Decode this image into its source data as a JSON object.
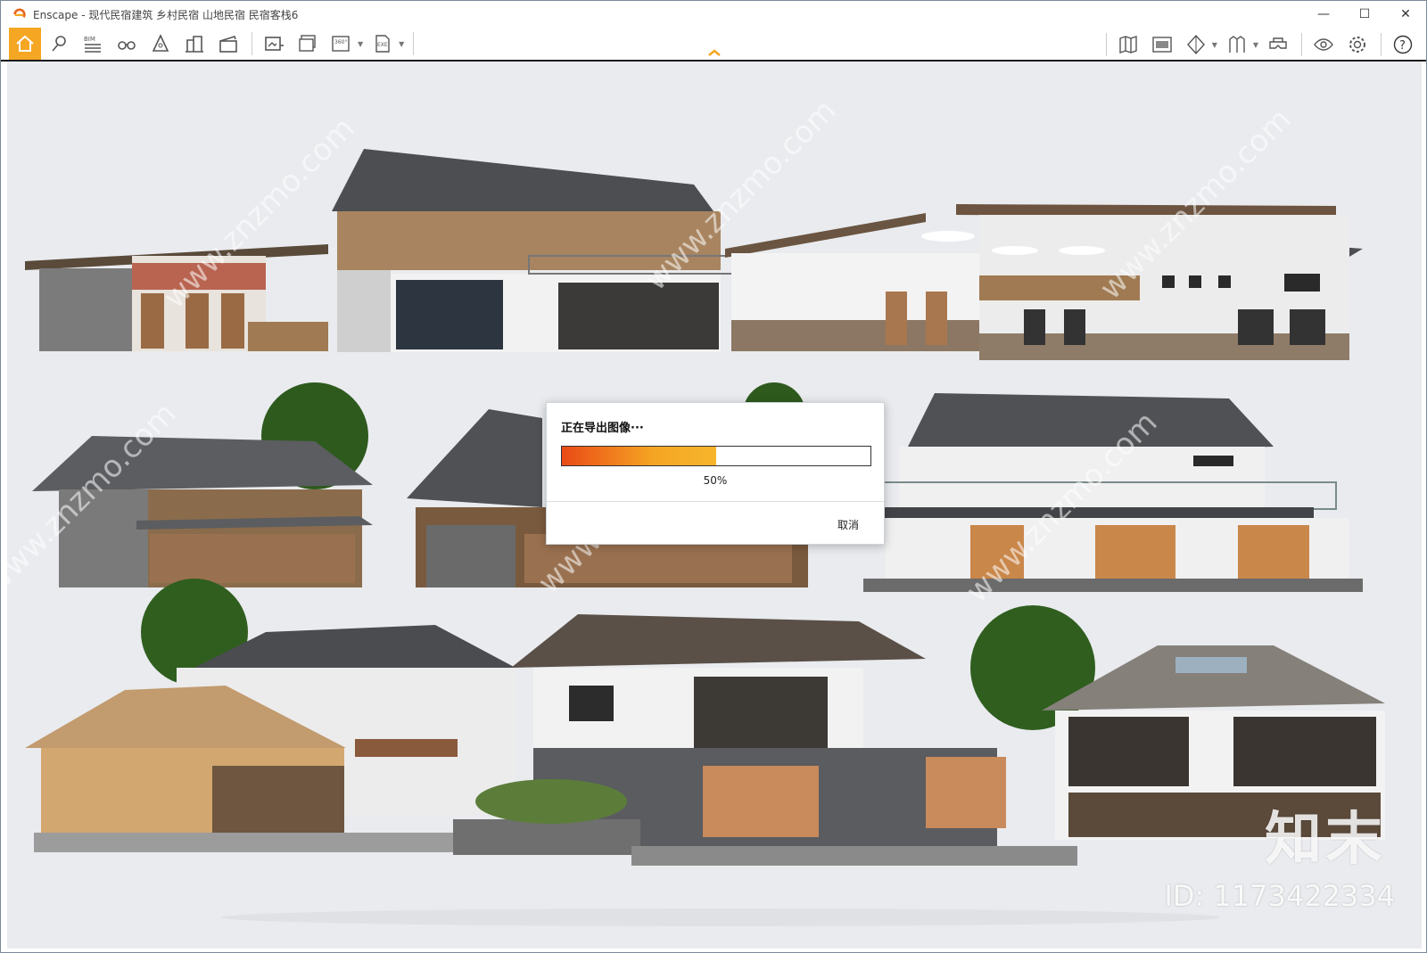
{
  "window": {
    "title": "Enscape - 现代民宿建筑 乡村民宿 山地民宿 民宿客栈6",
    "minimize_glyph": "—",
    "maximize_glyph": "☐",
    "close_glyph": "✕"
  },
  "toolbar": {
    "left_icons": [
      "home-icon",
      "location-icon",
      "bim-icon",
      "binoculars-icon",
      "perspective-icon",
      "buildings-icon",
      "clapper-icon"
    ],
    "export_icons": [
      "render-export-icon",
      "batch-render-icon",
      "panorama-360-icon",
      "exe-export-icon"
    ],
    "right_icons": [
      "map-icon",
      "gallery-icon",
      "material-icon",
      "asset-library-icon",
      "vr-headset-icon",
      "visual-settings-icon",
      "gear-icon",
      "help-icon"
    ],
    "bim_label": "BIM",
    "pano_label": "360°",
    "exe_label": "EXE",
    "help_label": "?"
  },
  "colors": {
    "accent": "#f5a623",
    "progress_start": "#ea4a16",
    "progress_end": "#f7b52c"
  },
  "dialog": {
    "title": "正在导出图像···",
    "progress": 0.5,
    "progress_text": "50%",
    "cancel_label": "取消"
  },
  "watermark": {
    "site": "www.znzmo.com",
    "brand": "知末",
    "id_text": "ID: 1173422334"
  }
}
